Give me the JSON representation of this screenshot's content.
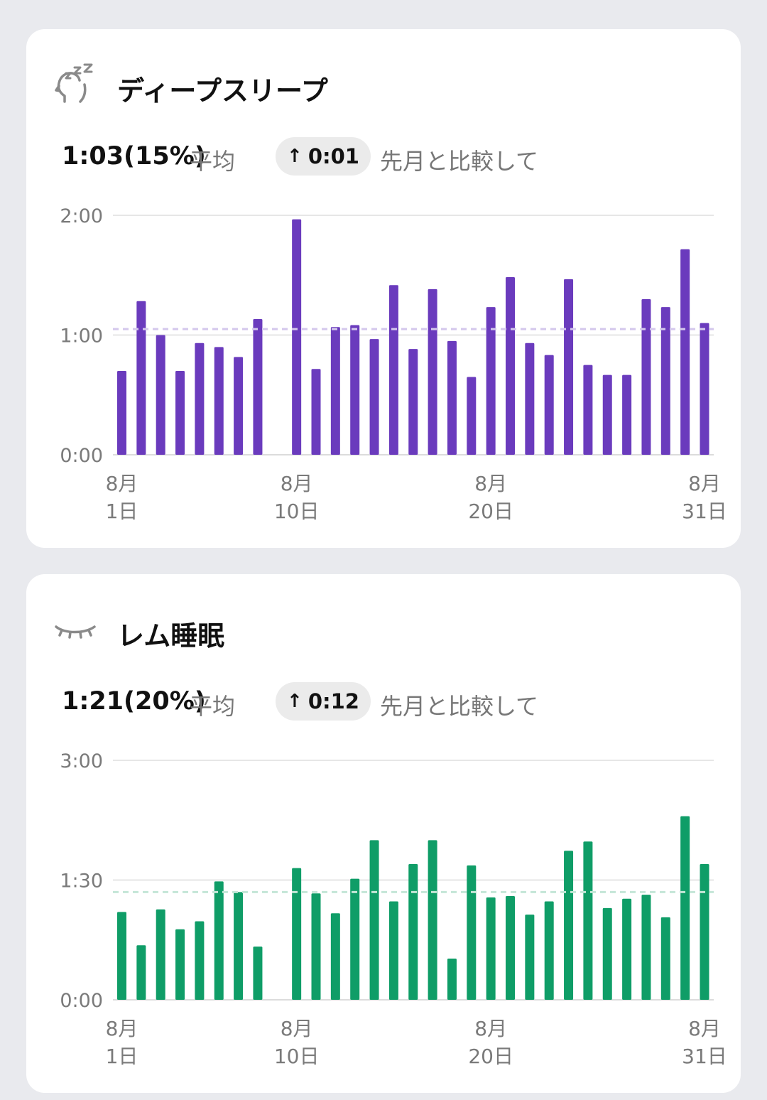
{
  "cards": [
    {
      "id": "deep",
      "title": "ディープスリープ",
      "icon": "sleeping-head-icon",
      "stat_value": "1:03(15%)",
      "stat_label": "平均",
      "delta": "0:01",
      "delta_icon": "arrow-up-icon",
      "compare_label": "先月と比較して",
      "accent_color": "#6a3bbd",
      "average_line_color": "#d4c8ec",
      "chart_data": {
        "type": "bar",
        "x_unit": "day of August",
        "y_unit": "minutes",
        "ylim": [
          0,
          120
        ],
        "yticks": [
          "0:00",
          "1:00",
          "2:00"
        ],
        "average": 63,
        "xticks": [
          {
            "day": 1,
            "month": "8月",
            "label": "1日"
          },
          {
            "day": 10,
            "month": "8月",
            "label": "10日"
          },
          {
            "day": 20,
            "month": "8月",
            "label": "20日"
          },
          {
            "day": 31,
            "month": "8月",
            "label": "31日"
          }
        ],
        "days": [
          1,
          2,
          3,
          4,
          5,
          6,
          7,
          8,
          9,
          10,
          11,
          12,
          13,
          14,
          15,
          16,
          17,
          18,
          19,
          20,
          21,
          22,
          23,
          24,
          25,
          26,
          27,
          28,
          29,
          30,
          31
        ],
        "values": [
          42,
          77,
          60,
          42,
          56,
          54,
          49,
          68,
          null,
          118,
          43,
          64,
          65,
          58,
          85,
          53,
          83,
          57,
          39,
          74,
          89,
          56,
          50,
          88,
          45,
          40,
          40,
          78,
          74,
          103,
          66
        ]
      }
    },
    {
      "id": "rem",
      "title": "レム睡眠",
      "icon": "closed-eye-icon",
      "stat_value": "1:21(20%)",
      "stat_label": "平均",
      "delta": "0:12",
      "delta_icon": "arrow-up-icon",
      "compare_label": "先月と比較して",
      "accent_color": "#0f9d67",
      "average_line_color": "#c4e6d7",
      "chart_data": {
        "type": "bar",
        "x_unit": "day of August",
        "y_unit": "minutes",
        "ylim": [
          0,
          180
        ],
        "yticks": [
          "0:00",
          "1:30",
          "3:00"
        ],
        "average": 81,
        "xticks": [
          {
            "day": 1,
            "month": "8月",
            "label": "1日"
          },
          {
            "day": 10,
            "month": "8月",
            "label": "10日"
          },
          {
            "day": 20,
            "month": "8月",
            "label": "20日"
          },
          {
            "day": 31,
            "month": "8月",
            "label": "31日"
          }
        ],
        "days": [
          1,
          2,
          3,
          4,
          5,
          6,
          7,
          8,
          9,
          10,
          11,
          12,
          13,
          14,
          15,
          16,
          17,
          18,
          19,
          20,
          21,
          22,
          23,
          24,
          25,
          26,
          27,
          28,
          29,
          30,
          31
        ],
        "values": [
          66,
          41,
          68,
          53,
          59,
          89,
          81,
          40,
          null,
          99,
          80,
          65,
          91,
          120,
          74,
          102,
          120,
          31,
          101,
          77,
          78,
          64,
          74,
          112,
          119,
          69,
          76,
          79,
          62,
          138,
          102
        ]
      }
    }
  ]
}
